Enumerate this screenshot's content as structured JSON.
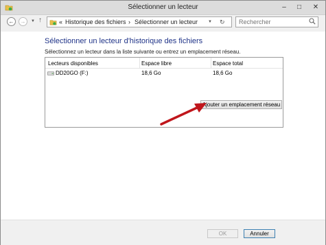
{
  "window": {
    "title": "Sélectionner un lecteur",
    "minimize_icon": "minimize-icon",
    "maximize_icon": "maximize-icon",
    "close_icon": "close-icon"
  },
  "navbar": {
    "back_icon": "back-arrow-icon",
    "forward_icon": "forward-arrow-icon",
    "up_icon": "up-arrow-icon",
    "breadcrumb_prefix": "«",
    "breadcrumb": [
      "Historique des fichiers",
      "Sélectionner un lecteur"
    ],
    "separator": "›",
    "refresh_icon": "refresh-icon",
    "search_placeholder": "Rechercher"
  },
  "main": {
    "heading": "Sélectionner un lecteur d'historique des fichiers",
    "description": "Sélectionnez un lecteur dans la liste suivante ou entrez un emplacement réseau.",
    "table": {
      "columns": [
        "Lecteurs disponibles",
        "Espace libre",
        "Espace total"
      ],
      "rows": [
        {
          "drive": "DD20GO (F:)",
          "free": "18,6 Go",
          "total": "18,6 Go"
        }
      ]
    },
    "add_network_label": "Ajouter un emplacement réseau"
  },
  "footer": {
    "ok_label": "OK",
    "cancel_label": "Annuler"
  },
  "colors": {
    "heading": "#1e3287",
    "annotation_arrow": "#c0161c"
  }
}
